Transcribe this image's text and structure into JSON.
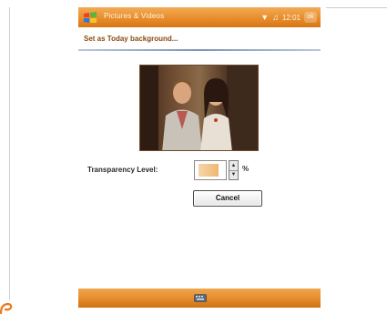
{
  "window": {
    "title": "Pictures & Videos",
    "status_icons": [
      "signal-icon",
      "volume-icon"
    ],
    "time": "12:01",
    "ok_label": "ok"
  },
  "dialog": {
    "subtitle": "Set as Today background...",
    "transparency_label": "Transparency Level:",
    "transparency_value": "",
    "percent_sign": "%",
    "cancel_label": "Cancel"
  },
  "menubar": {
    "keyboard_icon": "keyboard-icon"
  },
  "colors": {
    "accent": "#e88d2c",
    "accent_dark": "#d57614",
    "divider": "#7e96b6"
  }
}
